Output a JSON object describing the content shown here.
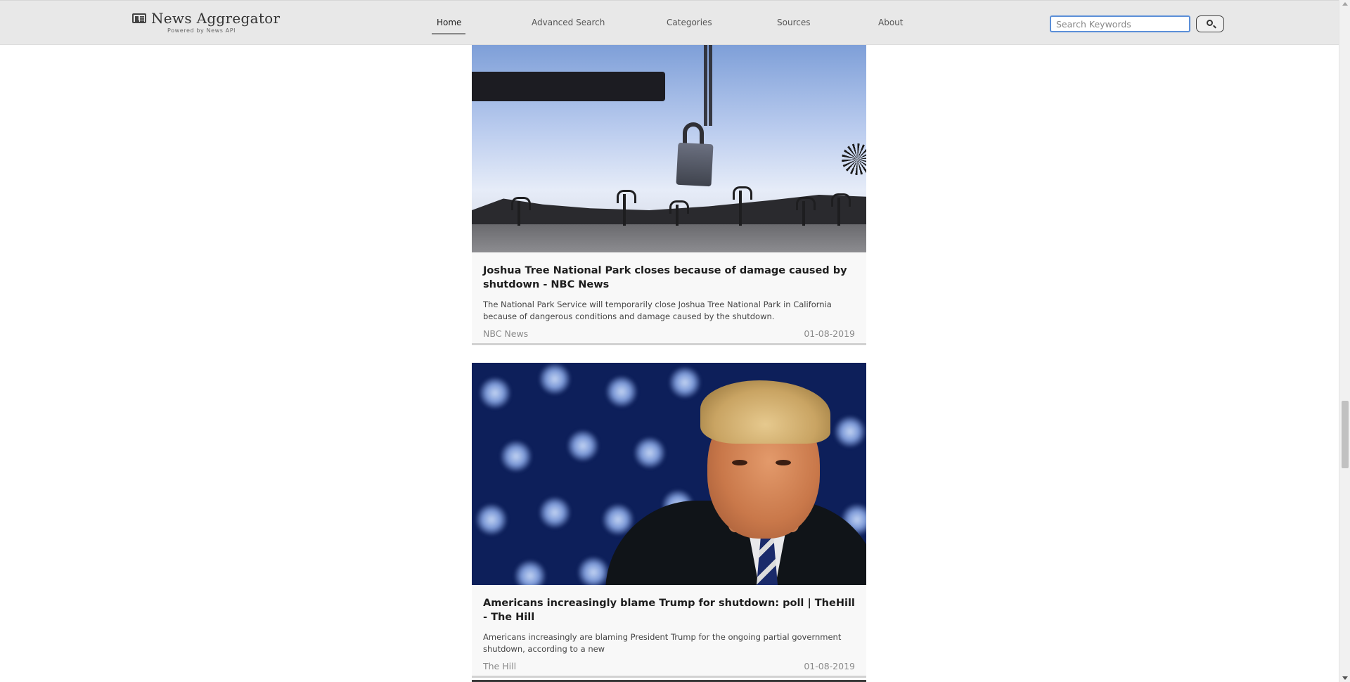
{
  "brand": {
    "title": "News Aggregator",
    "subtitle": "Powered by News API",
    "icon": "newspaper-icon"
  },
  "nav": {
    "items": [
      {
        "label": "Home",
        "active": true
      },
      {
        "label": "Advanced Search",
        "active": false
      },
      {
        "label": "Categories",
        "active": false
      },
      {
        "label": "Sources",
        "active": false
      },
      {
        "label": "About",
        "active": false
      }
    ]
  },
  "search": {
    "placeholder": "Search Keywords",
    "value": "",
    "button_icon": "search-icon"
  },
  "articles": [
    {
      "title": "Joshua Tree National Park closes because of damage caused by shutdown - NBC News",
      "description": "The National Park Service will temporarily close Joshua Tree National Park in California because of dangerous conditions and damage caused by the shutdown.",
      "source": "NBC News",
      "date": "01-08-2019"
    },
    {
      "title": "Americans increasingly blame Trump for shutdown: poll | TheHill - The Hill",
      "description": "Americans increasingly are blaming President Trump for the ongoing partial government shutdown, according to a new",
      "source": "The Hill",
      "date": "01-08-2019"
    }
  ],
  "colors": {
    "navbar_bg": "#e8e8e8",
    "search_focus": "#5b8fd8",
    "card_bg": "#f8f8f8",
    "meta_text": "#8a8a8a"
  }
}
